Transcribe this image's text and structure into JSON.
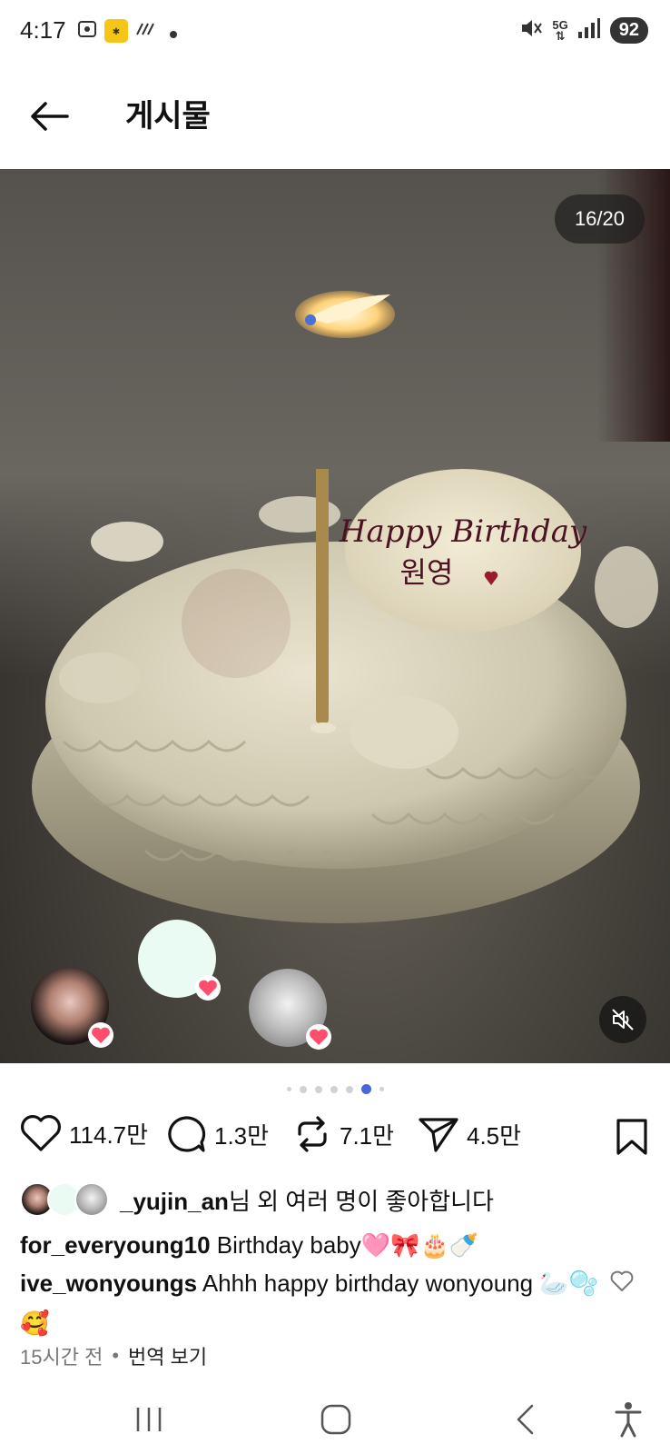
{
  "status_bar": {
    "time": "4:17",
    "battery": "92",
    "network": "5G"
  },
  "header": {
    "title": "게시물",
    "back_icon": "arrow-left-icon"
  },
  "media": {
    "counter": "16/20",
    "cake_message_line1": "Happy Birthday",
    "cake_message_line2": "원영",
    "mute_icon": "speaker-muted-icon",
    "carousel_dots": 7,
    "active_dot": 5
  },
  "actions": {
    "likes": "114.7만",
    "comments": "1.3만",
    "reposts": "7.1만",
    "shares": "4.5만"
  },
  "liked_by": {
    "username": "_yujin_an",
    "suffix": "님 외 여러 명이 좋아합니다"
  },
  "caption": {
    "username": "for_everyoung10",
    "text": "Birthday baby🩷🎀🎂🍼"
  },
  "comment": {
    "username": "ive_wonyoungs",
    "text": "Ahhh happy birthday wonyoung 🦢🫧🥰"
  },
  "meta": {
    "time_ago": "15시간 전",
    "separator": "•",
    "translate": "번역 보기"
  },
  "colors": {
    "accent_dot": "#4a67d6",
    "heart_badge": "#ff4d6d"
  }
}
